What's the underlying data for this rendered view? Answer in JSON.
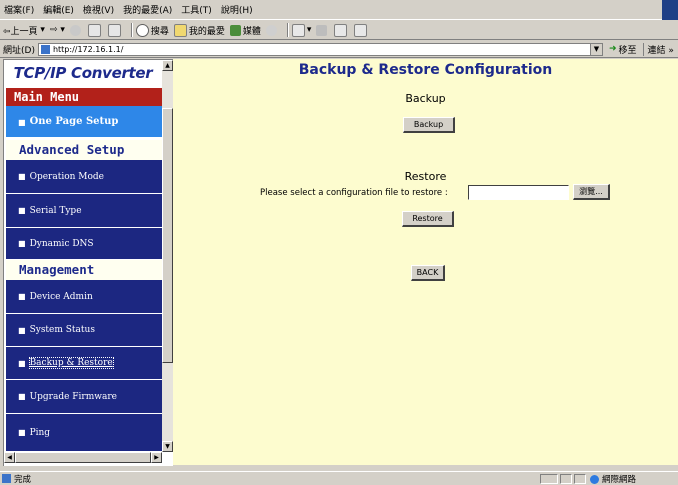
{
  "browser": {
    "menu": [
      "檔案(F)",
      "編輯(E)",
      "檢視(V)",
      "我的最愛(A)",
      "工具(T)",
      "說明(H)"
    ],
    "toolbar": {
      "back": "⇦上一頁",
      "forward": "⇨",
      "search": "搜尋",
      "favorites": "我的最愛",
      "media": "媒體"
    },
    "address": {
      "label": "網址(D)",
      "url": "http://172.16.1.1/",
      "go": "移至",
      "links": "連結 »"
    },
    "status": {
      "text": "完成",
      "zone": "網際網路"
    }
  },
  "sidebar": {
    "logo": "TCP/IP Converter",
    "sections": {
      "main": "Main Menu",
      "advanced": "Advanced Setup",
      "management": "Management"
    },
    "items": {
      "one_page_setup": "One Page Setup",
      "operation_mode": "Operation Mode",
      "serial_type": "Serial Type",
      "dynamic_dns": "Dynamic DNS",
      "device_admin": "Device Admin",
      "system_status": "System Status",
      "backup_restore": "Backup & Restore",
      "upgrade_firmware": "Upgrade Firmware",
      "ping": "Ping"
    },
    "bullet": "■"
  },
  "main": {
    "title": "Backup & Restore Configuration",
    "backup_heading": "Backup",
    "backup_button": "Backup",
    "restore_heading": "Restore",
    "restore_label": "Please select a configuration file to restore :",
    "file_value": "",
    "browse_button": "瀏覽...",
    "restore_button": "Restore",
    "back_button": "BACK"
  },
  "colors": {
    "nav_bg": "#1c2781",
    "nav_active_bg": "#2e87e8",
    "section_red": "#b2211a",
    "content_bg": "#fdfccf",
    "title_blue": "#1d2a8c"
  }
}
